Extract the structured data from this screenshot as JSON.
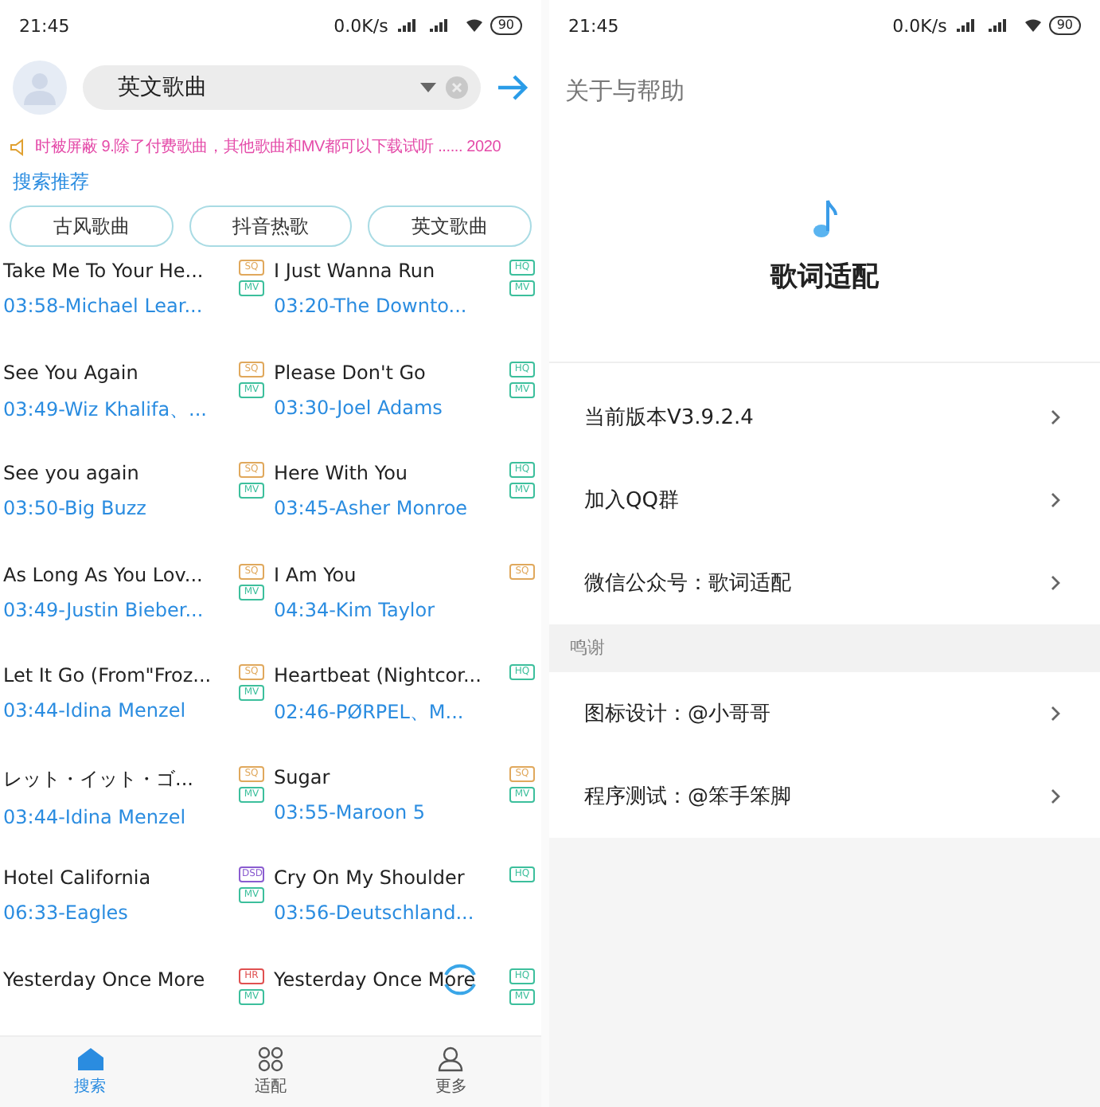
{
  "left_screen": {
    "status_bar": {
      "time": "21:45",
      "speed": "0.0K/s",
      "battery": "90"
    },
    "search": {
      "value": "英文歌曲"
    },
    "notice": "时被屏蔽 9.除了付费歌曲，其他歌曲和MV都可以下载试听 ...... 2020",
    "recommend_label": "搜索推荐",
    "chips": [
      "古风歌曲",
      "抖音热歌",
      "英文歌曲"
    ],
    "songs": [
      {
        "title": "Take Me To Your He...",
        "meta": "03:58-Michael Lear...",
        "badges": [
          {
            "kind": "sq",
            "text": "SQ"
          },
          {
            "kind": "mv",
            "text": "MV"
          }
        ]
      },
      {
        "title": "I Just Wanna Run",
        "meta": "03:20-The Downto...",
        "badges": [
          {
            "kind": "hq",
            "text": "HQ"
          },
          {
            "kind": "mv",
            "text": "MV"
          }
        ]
      },
      {
        "title": "See You Again",
        "meta": "03:49-Wiz Khalifa、...",
        "badges": [
          {
            "kind": "sq",
            "text": "SQ"
          },
          {
            "kind": "mv",
            "text": "MV"
          }
        ]
      },
      {
        "title": "Please Don't Go",
        "meta": "03:30-Joel Adams",
        "badges": [
          {
            "kind": "hq",
            "text": "HQ"
          },
          {
            "kind": "mv",
            "text": "MV"
          }
        ]
      },
      {
        "title": "See you again",
        "meta": "03:50-Big Buzz",
        "badges": [
          {
            "kind": "sq",
            "text": "SQ"
          },
          {
            "kind": "mv",
            "text": "MV"
          }
        ]
      },
      {
        "title": "Here With You",
        "meta": "03:45-Asher Monroe",
        "badges": [
          {
            "kind": "hq",
            "text": "HQ"
          },
          {
            "kind": "mv",
            "text": "MV"
          }
        ]
      },
      {
        "title": "As Long As You Lov...",
        "meta": "03:49-Justin Bieber...",
        "badges": [
          {
            "kind": "sq",
            "text": "SQ"
          },
          {
            "kind": "mv",
            "text": "MV"
          }
        ]
      },
      {
        "title": "I Am You",
        "meta": "04:34-Kim Taylor",
        "badges": [
          {
            "kind": "sq",
            "text": "SQ"
          }
        ]
      },
      {
        "title": "Let It Go (From\"Froz...",
        "meta": "03:44-Idina Menzel",
        "badges": [
          {
            "kind": "sq",
            "text": "SQ"
          },
          {
            "kind": "mv",
            "text": "MV"
          }
        ]
      },
      {
        "title": "Heartbeat (Nightcor...",
        "meta": "02:46-PØRPEL、M...",
        "badges": [
          {
            "kind": "hq",
            "text": "HQ"
          }
        ]
      },
      {
        "title": "レット・イット・ゴ...",
        "meta": "03:44-Idina Menzel",
        "badges": [
          {
            "kind": "sq",
            "text": "SQ"
          },
          {
            "kind": "mv",
            "text": "MV"
          }
        ]
      },
      {
        "title": "Sugar",
        "meta": "03:55-Maroon 5",
        "badges": [
          {
            "kind": "sq",
            "text": "SQ"
          },
          {
            "kind": "mv",
            "text": "MV"
          }
        ]
      },
      {
        "title": "Hotel California",
        "meta": "06:33-Eagles",
        "badges": [
          {
            "kind": "dsd",
            "text": "DSD"
          },
          {
            "kind": "mv",
            "text": "MV"
          }
        ]
      },
      {
        "title": "Cry On My Shoulder",
        "meta": "03:56-Deutschland...",
        "badges": [
          {
            "kind": "hq",
            "text": "HQ"
          }
        ]
      },
      {
        "title": "Yesterday Once More",
        "badges": [
          {
            "kind": "hr",
            "text": "HR"
          },
          {
            "kind": "mv",
            "text": "MV"
          }
        ]
      },
      {
        "title": "Yesterday Once More",
        "badges": [
          {
            "kind": "hq",
            "text": "HQ"
          },
          {
            "kind": "mv",
            "text": "MV"
          }
        ]
      }
    ],
    "tabs": [
      {
        "kind": "home",
        "label": "搜索",
        "selected": true
      },
      {
        "kind": "grid",
        "label": "适配",
        "selected": false
      },
      {
        "kind": "person",
        "label": "更多",
        "selected": false
      }
    ]
  },
  "right_screen": {
    "status_bar": {
      "time": "21:45",
      "speed": "0.0K/s",
      "battery": "90"
    },
    "title": "关于与帮助",
    "app_name": "歌词适配",
    "items": [
      "当前版本V3.9.2.4",
      "加入QQ群",
      "微信公众号：歌词适配"
    ],
    "section": "鸣谢",
    "credits": [
      "图标设计：@小哥哥",
      "程序测试：@笨手笨脚"
    ]
  }
}
